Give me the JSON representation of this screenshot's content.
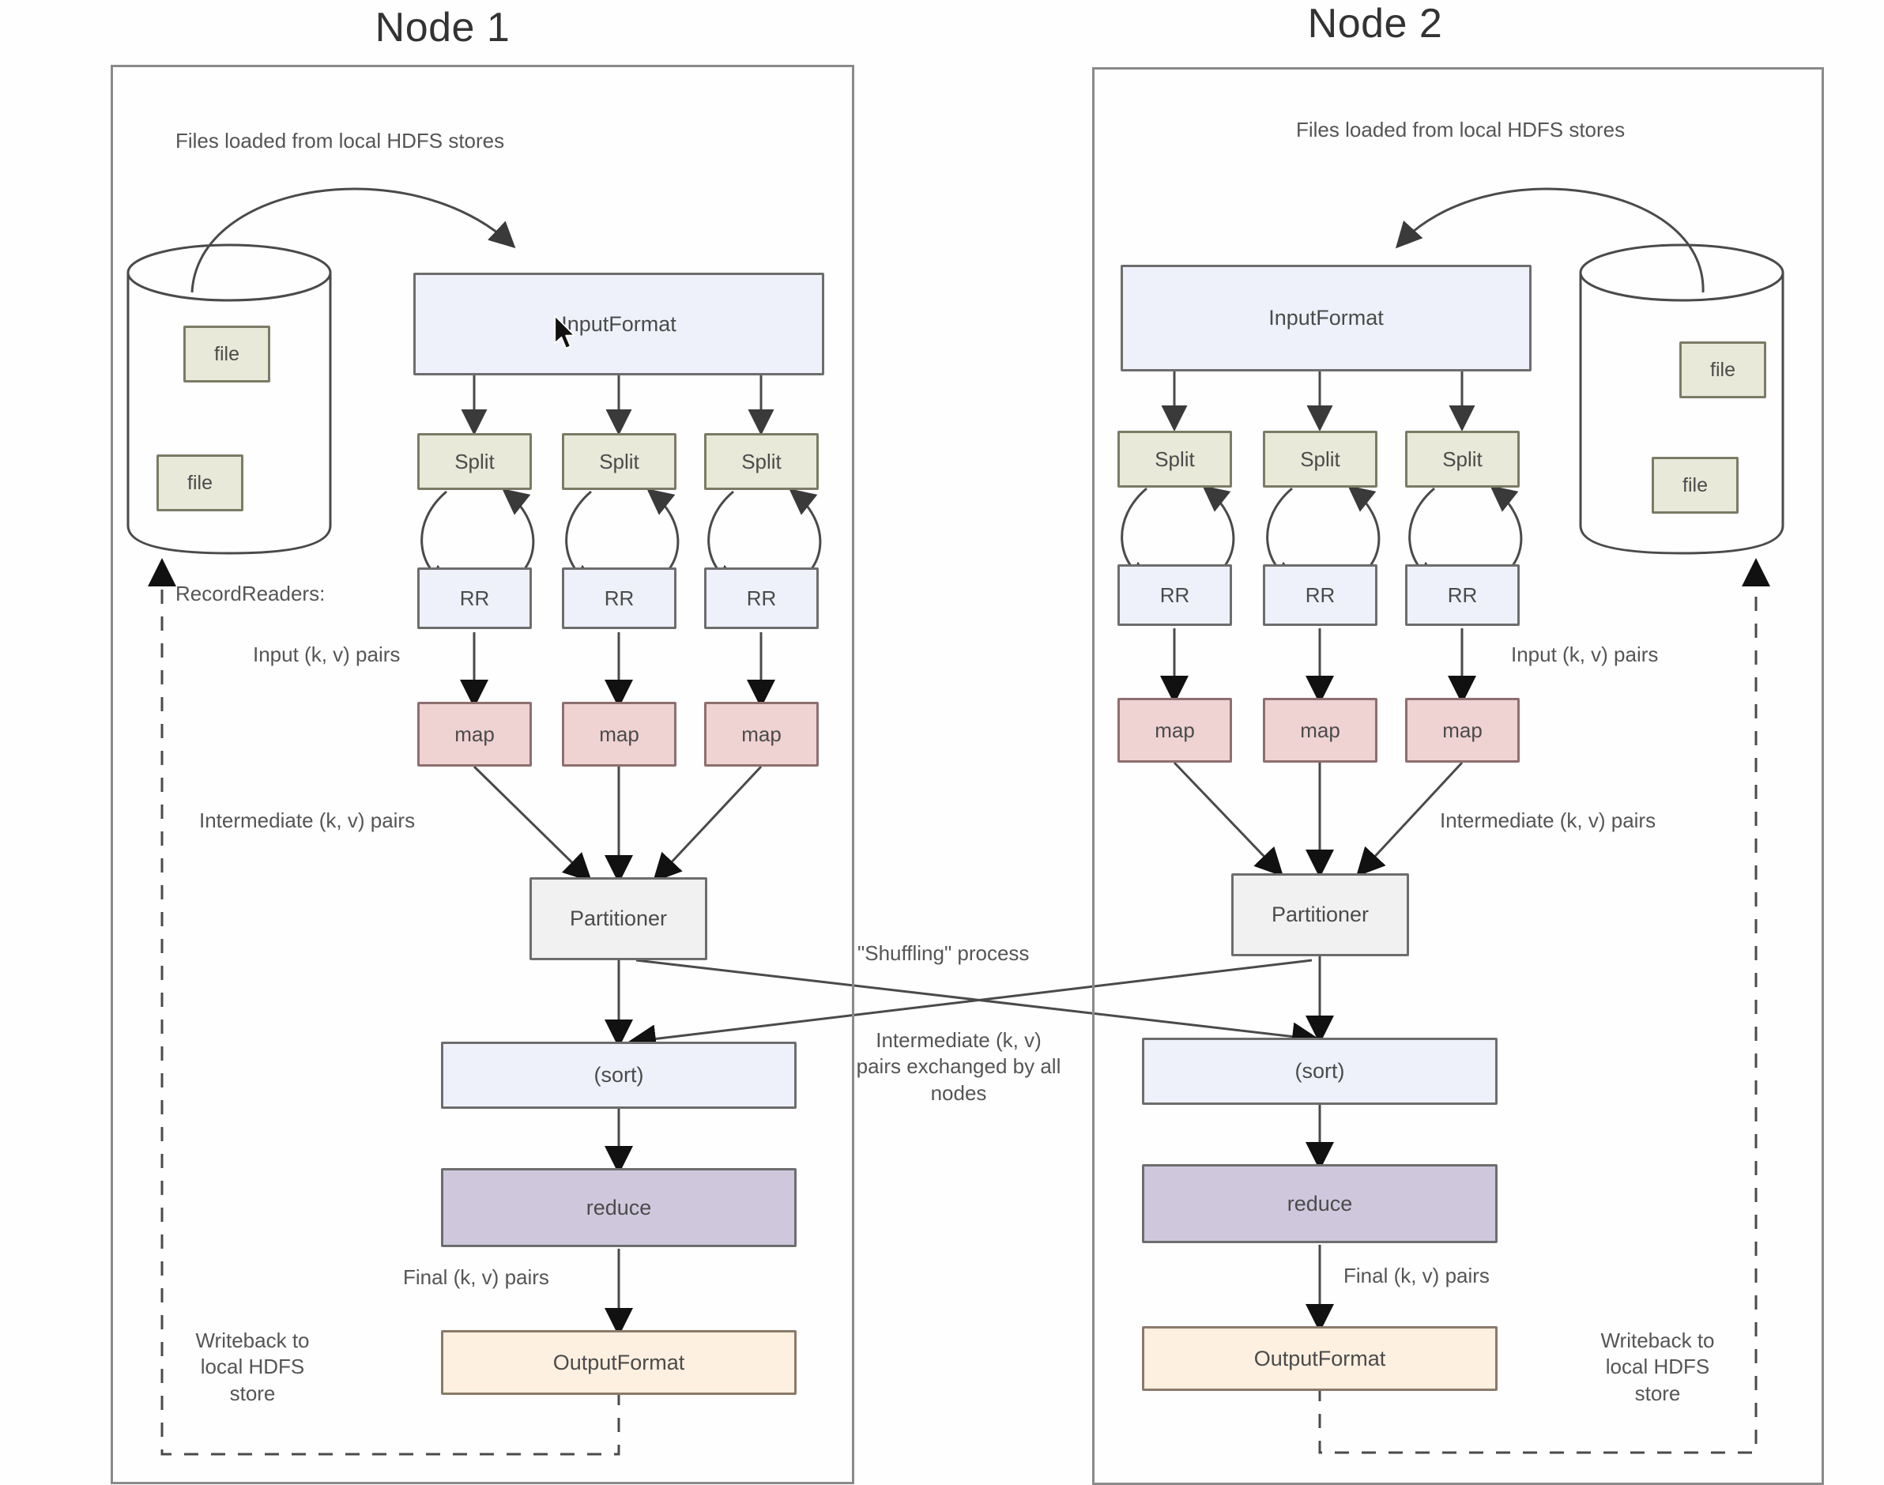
{
  "nodes": [
    {
      "title": "Node 1",
      "hdfs_label": "Files loaded from local HDFS stores",
      "inputformat": "InputFormat",
      "splits": [
        "Split",
        "Split",
        "Split"
      ],
      "recordreaders": [
        "RR",
        "RR",
        "RR"
      ],
      "recordreaders_label": "RecordReaders:",
      "maps": [
        "map",
        "map",
        "map"
      ],
      "input_pairs_label": "Input (k, v) pairs",
      "intermediate_pairs_label": "Intermediate (k, v) pairs",
      "partitioner": "Partitioner",
      "sort": "(sort)",
      "reduce": "reduce",
      "final_pairs_label": "Final (k, v) pairs",
      "outputformat": "OutputFormat",
      "writeback_label": "Writeback to local HDFS store",
      "files": [
        "file",
        "file"
      ]
    },
    {
      "title": "Node 2",
      "hdfs_label": "Files loaded from local HDFS stores",
      "inputformat": "InputFormat",
      "splits": [
        "Split",
        "Split",
        "Split"
      ],
      "recordreaders": [
        "RR",
        "RR",
        "RR"
      ],
      "maps": [
        "map",
        "map",
        "map"
      ],
      "input_pairs_label": "Input (k, v) pairs",
      "intermediate_pairs_label": "Intermediate (k, v) pairs",
      "partitioner": "Partitioner",
      "sort": "(sort)",
      "reduce": "reduce",
      "final_pairs_label": "Final (k, v) pairs",
      "outputformat": "OutputFormat",
      "writeback_label": "Writeback to local HDFS store",
      "files": [
        "file",
        "file"
      ]
    }
  ],
  "shuffle": {
    "process_label": "\"Shuffling\" process",
    "exchange_label": "Intermediate (k, v) pairs exchanged by all nodes"
  },
  "colors": {
    "inputformat": "#eef1f9",
    "split": "#e8e9d8",
    "recordreader": "#eef1f9",
    "map": "#efd2d2",
    "partitioner": "#f1f1f1",
    "sort": "#eef1f9",
    "reduce": "#cfc8dd",
    "outputformat": "#fdf0e0",
    "stroke": "#6d6d6d",
    "text": "#555555"
  }
}
